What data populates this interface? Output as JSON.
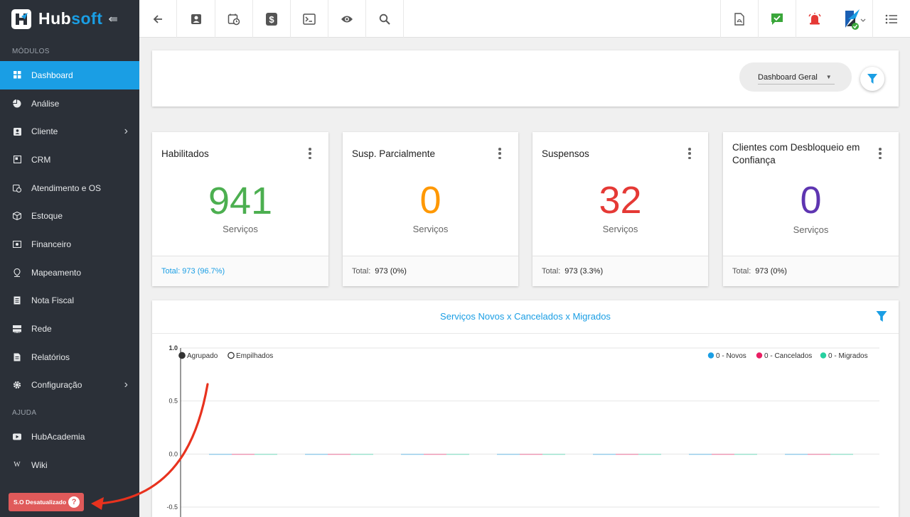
{
  "sidebar": {
    "brand": {
      "hub": "Hub",
      "soft": "soft"
    },
    "sections": {
      "modulos": "MÓDULOS",
      "ajuda": "AJUDA"
    },
    "items": [
      {
        "label": "Dashboard",
        "icon": "grid-icon",
        "active": true
      },
      {
        "label": "Análise",
        "icon": "pie-icon"
      },
      {
        "label": "Cliente",
        "icon": "contact-icon",
        "has_children": true
      },
      {
        "label": "CRM",
        "icon": "crm-icon"
      },
      {
        "label": "Atendimento e OS",
        "icon": "calendar-clock-icon"
      },
      {
        "label": "Estoque",
        "icon": "box-icon"
      },
      {
        "label": "Financeiro",
        "icon": "money-icon"
      },
      {
        "label": "Mapeamento",
        "icon": "pin-icon"
      },
      {
        "label": "Nota Fiscal",
        "icon": "receipt-icon"
      },
      {
        "label": "Rede",
        "icon": "server-icon"
      },
      {
        "label": "Relatórios",
        "icon": "report-icon"
      },
      {
        "label": "Configuração",
        "icon": "gear-icon",
        "has_children": true
      }
    ],
    "help_items": [
      {
        "label": "HubAcademia",
        "icon": "youtube-icon"
      },
      {
        "label": "Wiki",
        "icon": "wiki-icon",
        "glyph": "W"
      }
    ],
    "badge": {
      "label": "S.O Desatualizado",
      "glyph": "?"
    }
  },
  "topbar": {
    "left_buttons": [
      "back-arrow-icon",
      "contact-card-icon",
      "calendar-clock-icon",
      "dollar-icon",
      "terminal-icon",
      "eye-icon",
      "search-icon"
    ],
    "right_buttons": [
      "pdf-icon",
      "chat-check-icon",
      "alarm-icon",
      "avatar",
      "list-icon"
    ]
  },
  "dashboard": {
    "select_label": "Dashboard Geral"
  },
  "cards": [
    {
      "title": "Habilitados",
      "value": "941",
      "unit": "Serviços",
      "total_label": "Total:",
      "total_value": "973 (96.7%)",
      "color": "#4caf50",
      "foot_link": true
    },
    {
      "title": "Susp. Parcialmente",
      "value": "0",
      "unit": "Serviços",
      "total_label": "Total:",
      "total_value": "973 (0%)",
      "color": "#ff9800"
    },
    {
      "title": "Suspensos",
      "value": "32",
      "unit": "Serviços",
      "total_label": "Total:",
      "total_value": "973 (3.3%)",
      "color": "#e53935"
    },
    {
      "title": "Clientes com Desbloqueio em Confiança",
      "value": "0",
      "unit": "Serviços",
      "total_label": "Total:",
      "total_value": "973 (0%)",
      "color": "#5e35b1"
    }
  ],
  "colors": {
    "accent": "#1a9ee4",
    "sidebar_bg": "#2b3038",
    "novos": "#1a9ee4",
    "cancelados": "#e91e63",
    "migrados": "#26d0a0",
    "annotation_arrow": "#e8321e"
  },
  "chart_data": {
    "type": "bar",
    "title": "Serviços Novos x Cancelados x Migrados",
    "mode_options": [
      "Agrupado",
      "Empilhados"
    ],
    "mode_selected": "Agrupado",
    "ylim": [
      -0.5,
      1.0
    ],
    "yticks": [
      "1.0",
      "0.5",
      "0.0",
      "-0.5"
    ],
    "ytick_values": [
      1.0,
      0.5,
      0.0,
      -0.5
    ],
    "groups": 7,
    "grid": true,
    "legend_position": "top-right",
    "series": [
      {
        "name": "Novos",
        "legend": "0 - Novos",
        "values": [
          0,
          0,
          0,
          0,
          0,
          0,
          0
        ]
      },
      {
        "name": "Cancelados",
        "legend": "0 - Cancelados",
        "values": [
          0,
          0,
          0,
          0,
          0,
          0,
          0
        ]
      },
      {
        "name": "Migrados",
        "legend": "0 - Migrados",
        "values": [
          0,
          0,
          0,
          0,
          0,
          0,
          0
        ]
      }
    ]
  }
}
